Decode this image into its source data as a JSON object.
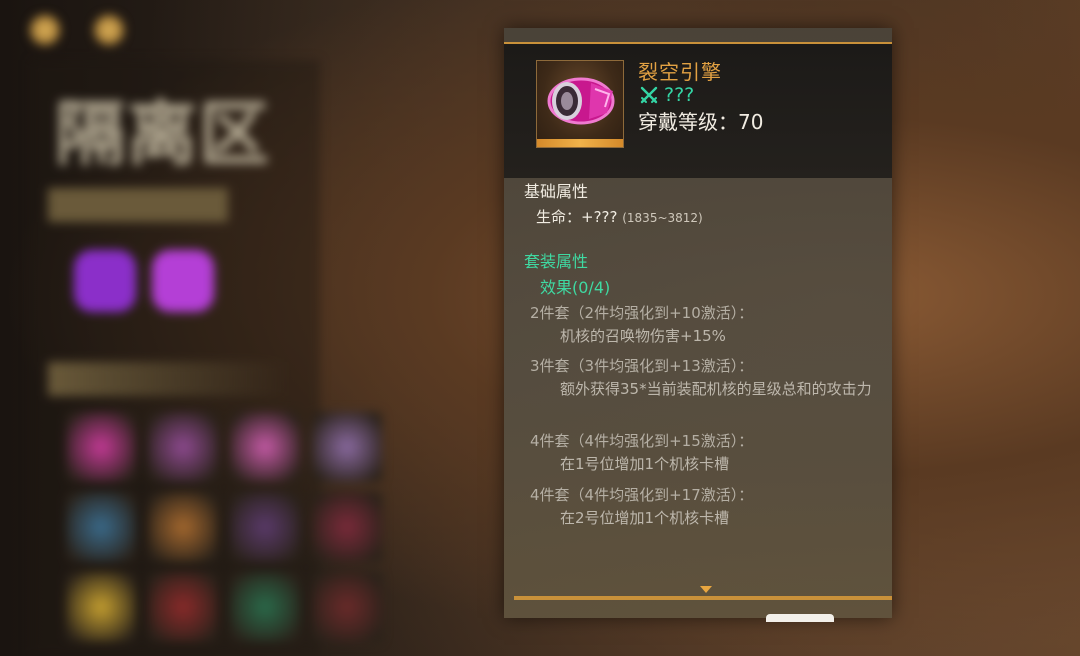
{
  "background": {
    "title": "隔离区",
    "colors": {
      "bg_dark": "#1a1410",
      "bg_warm": "#8a5a34"
    },
    "gems": [
      "#8b2fc9",
      "#b43fd6"
    ],
    "grid_cells": [
      "#c43a96",
      "#8e4a90",
      "#c55aa6",
      "#8a6aa0",
      "#3a6a8a",
      "#a4682e",
      "#5a3a6a",
      "#7a2a3a",
      "#c6a030",
      "#8a2a2a",
      "#2a6a4a",
      "#6a2a2a"
    ]
  },
  "tooltip": {
    "item_name": "裂空引擎",
    "level_icon": "crossed-swords-icon",
    "level_text": "???",
    "wear_text": "穿戴等级：70",
    "rarity_color": "#e2a143",
    "accent_color": "#c9913a",
    "base_section_title": "基础属性",
    "base_stat_label": "生命：+???",
    "base_stat_range": "(1835~3812)",
    "set_section_title": "套装属性",
    "effect_count": "效果(0/4)",
    "sets": [
      {
        "header": "2件套（2件均强化到+10激活）：",
        "desc": "机核的召唤物伤害+15%"
      },
      {
        "header": "3件套（3件均强化到+13激活）：",
        "desc": "额外获得35*当前装配机核的星级总和的攻击力"
      },
      {
        "header": "4件套（4件均强化到+15激活）：",
        "desc": "在1号位增加1个机核卡槽"
      },
      {
        "header": "4件套（4件均强化到+17激活）：",
        "desc": "在2号位增加1个机核卡槽"
      }
    ],
    "footer_icon": "chevron-down-icon"
  }
}
